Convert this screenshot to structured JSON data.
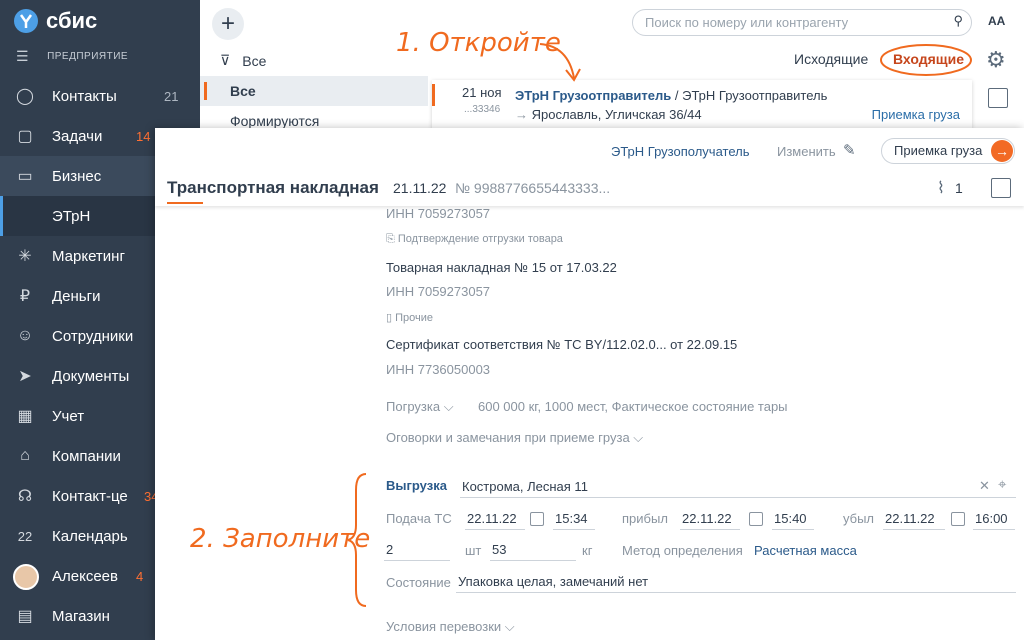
{
  "app": {
    "logo_text": "сбис",
    "company": "ПРЕДПРИЯТИЕ"
  },
  "sidebar": {
    "items": [
      {
        "label": "Контакты",
        "count": "21",
        "icon": "contacts-icon"
      },
      {
        "label": "Задачи",
        "count": "14",
        "icon": "tasks-icon"
      },
      {
        "label": "Бизнес",
        "count": "",
        "icon": "briefcase-icon"
      },
      {
        "label": "ЭТрН",
        "count": "",
        "icon": ""
      },
      {
        "label": "Маркетинг",
        "count": "",
        "icon": "marketing-icon"
      },
      {
        "label": "Деньги",
        "count": "",
        "icon": "money-icon"
      },
      {
        "label": "Сотрудники",
        "count": "",
        "icon": "employees-icon"
      },
      {
        "label": "Документы",
        "count": "",
        "icon": "documents-icon"
      },
      {
        "label": "Учет",
        "count": "",
        "icon": "accounting-icon"
      },
      {
        "label": "Компании",
        "count": "",
        "icon": "companies-icon"
      },
      {
        "label": "Контакт-це",
        "count": "34",
        "icon": "headset-icon"
      },
      {
        "label": "Календарь",
        "count": "",
        "icon": "calendar-icon"
      },
      {
        "label": "Алексеев",
        "count": "4",
        "icon": "avatar"
      },
      {
        "label": "Магазин",
        "count": "",
        "icon": "shop-icon"
      }
    ]
  },
  "filters": {
    "all_label": "Все",
    "items": [
      "Все",
      "Формируются"
    ]
  },
  "search": {
    "placeholder": "Поиск по номеру или контрагенту"
  },
  "font_toggle": "АА",
  "tabs": {
    "outgoing": "Исходящие",
    "incoming": "Входящие"
  },
  "list_row": {
    "date": "21 ноя",
    "number": "...33346",
    "title_bold": "ЭТрН Грузоотправитель",
    "title_rest": " / ЭТрН Грузоотправитель",
    "address": "Ярославль, Угличская 36/44",
    "status": "Приемка груза"
  },
  "annotations": {
    "step1": "1. Откройте",
    "step2": "2. Заполните"
  },
  "card": {
    "role": "ЭТрН Грузополучатель",
    "edit": "Изменить",
    "stage": "Приемка груза",
    "title": "Транспортная накладная",
    "date": "21.11.22",
    "number": "№ 9988776655443333...",
    "attachments": "1",
    "inn1": "ИНН 7059273057",
    "section1": "Подтверждение отгрузки товара",
    "doc1": "Товарная накладная № 15 от 17.03.22",
    "inn2": "ИНН 7059273057",
    "section2": "Прочие",
    "doc2": "Сертификат соответствия № ТС BY/112.02.0...  от 22.09.15",
    "inn3": "ИНН 7736050003",
    "loading_label": "Погрузка",
    "loading_value": "600 000 кг, 1000 мест, Фактическое состояние тары",
    "remarks_label": "Оговорки и замечания при приеме груза",
    "unloading_label": "Выгрузка",
    "unloading_address": "Кострома, Лесная 11",
    "arrival_label": "Подача ТС",
    "arrival_date": "22.11.22",
    "arrival_time": "15:34",
    "came_label": "прибыл",
    "came_date": "22.11.22",
    "came_time": "15:40",
    "left_label": "убыл",
    "left_date": "22.11.22",
    "left_time": "16:00",
    "pieces": "2",
    "pieces_unit": "шт",
    "weight": "53",
    "weight_unit": "кг",
    "method_label": "Метод определения",
    "method_value": "Расчетная масса",
    "state_label": "Состояние",
    "state_value": "Упаковка целая, замечаний нет",
    "transport_label": "Условия перевозки"
  }
}
